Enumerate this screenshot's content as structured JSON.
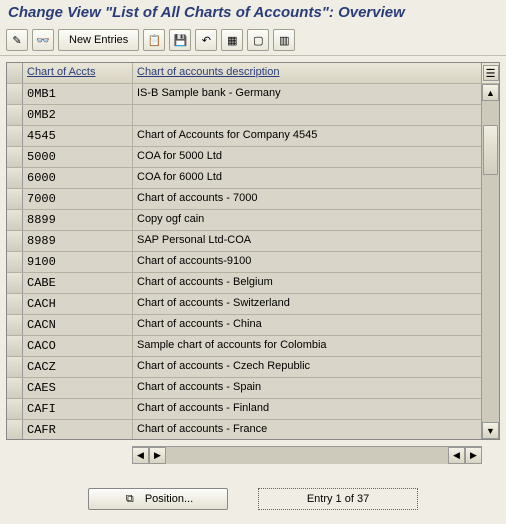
{
  "title": "Change View \"List of All Charts of Accounts\": Overview",
  "toolbar": {
    "new_entries": "New Entries"
  },
  "columns": {
    "col1": "Chart of Accts",
    "col2": "Chart of accounts description"
  },
  "rows": [
    {
      "code": "0MB1",
      "desc": "IS-B Sample bank - Germany"
    },
    {
      "code": "0MB2",
      "desc": ""
    },
    {
      "code": "4545",
      "desc": "Chart of Accounts for Company 4545"
    },
    {
      "code": "5000",
      "desc": "COA for 5000 Ltd"
    },
    {
      "code": "6000",
      "desc": "COA for 6000 Ltd"
    },
    {
      "code": "7000",
      "desc": "Chart of accounts - 7000"
    },
    {
      "code": "8899",
      "desc": "Copy ogf cain"
    },
    {
      "code": "8989",
      "desc": "SAP Personal Ltd-COA"
    },
    {
      "code": "9100",
      "desc": "Chart of accounts-9100"
    },
    {
      "code": "CABE",
      "desc": "Chart of accounts - Belgium"
    },
    {
      "code": "CACH",
      "desc": "Chart of accounts - Switzerland"
    },
    {
      "code": "CACN",
      "desc": "Chart of accounts - China"
    },
    {
      "code": "CACO",
      "desc": "Sample chart of accounts for Colombia"
    },
    {
      "code": "CACZ",
      "desc": "Chart of accounts - Czech Republic"
    },
    {
      "code": "CAES",
      "desc": "Chart of accounts - Spain"
    },
    {
      "code": "CAFI",
      "desc": "Chart of accounts - Finland"
    },
    {
      "code": "CAFR",
      "desc": "Chart of accounts - France"
    }
  ],
  "footer": {
    "position": "Position...",
    "entry": "Entry 1 of 37"
  },
  "icons": {
    "pencil": "✎",
    "glasses": "👓",
    "copy": "📋",
    "save": "💾",
    "undo": "↶",
    "select_all": "▦",
    "deselect": "▢",
    "columns": "▥",
    "config": "☰",
    "up": "▲",
    "down": "▼",
    "left": "◀",
    "right": "▶",
    "first": "⏮",
    "last": "⏭",
    "locate": "⧉"
  }
}
